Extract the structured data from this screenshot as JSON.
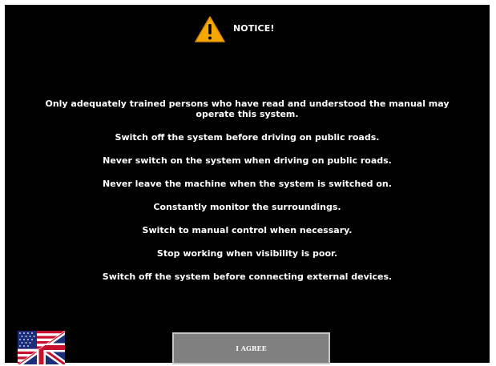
{
  "header": {
    "icon": "warning-triangle-icon",
    "title": "NOTICE!"
  },
  "messages": [
    "Only adequately trained persons who have read and understood the manual may operate this system.",
    "Switch off the system before driving on public roads.",
    "Never switch on the system when driving on public roads.",
    "Never leave the machine when the system is switched on.",
    "Constantly monitor the surroundings.",
    "Switch to manual control when necessary.",
    "Stop working when visibility is poor.",
    "Switch off the system before connecting external devices."
  ],
  "footer": {
    "language_icon": "us-uk-flag-icon",
    "agree_label": "I AGREE"
  },
  "colors": {
    "background": "#000000",
    "text": "#ffffff",
    "warning": "#f5a800",
    "button": "#808080"
  }
}
